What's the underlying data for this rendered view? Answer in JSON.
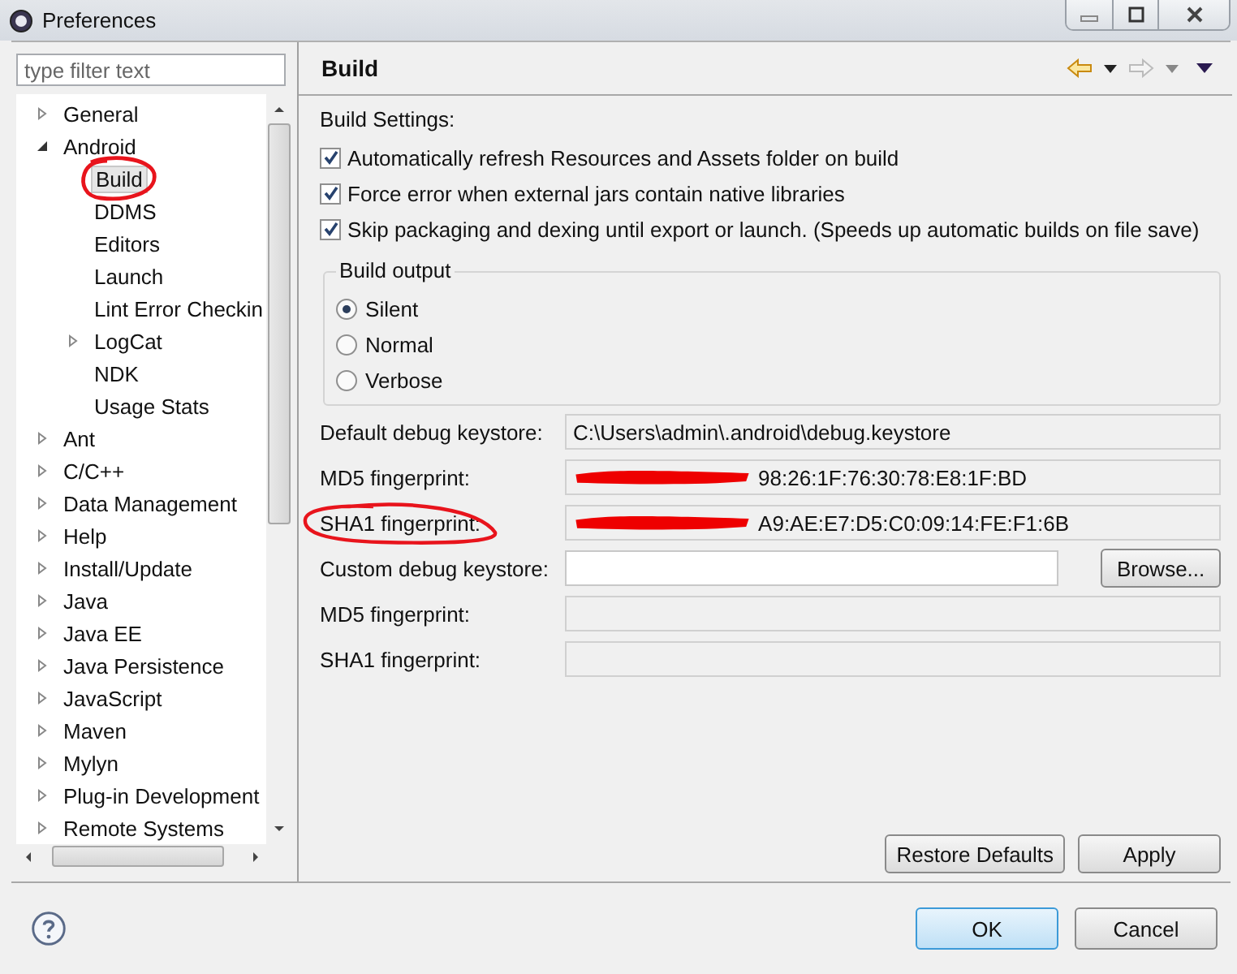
{
  "window": {
    "title": "Preferences"
  },
  "filter": {
    "placeholder": "type filter text"
  },
  "tree": [
    {
      "label": "General",
      "expanded": false,
      "selected": false
    },
    {
      "label": "Android",
      "expanded": true,
      "selected": false,
      "children": [
        {
          "label": "Build",
          "selected": true,
          "circled": true
        },
        {
          "label": "DDMS",
          "selected": false
        },
        {
          "label": "Editors",
          "selected": false
        },
        {
          "label": "Launch",
          "selected": false
        },
        {
          "label": "Lint Error Checkin",
          "selected": false
        },
        {
          "label": "LogCat",
          "expanded": false,
          "selected": false
        },
        {
          "label": "NDK",
          "selected": false
        },
        {
          "label": "Usage Stats",
          "selected": false
        }
      ]
    },
    {
      "label": "Ant",
      "expanded": false,
      "selected": false
    },
    {
      "label": "C/C++",
      "expanded": false,
      "selected": false
    },
    {
      "label": "Data Management",
      "expanded": false,
      "selected": false
    },
    {
      "label": "Help",
      "expanded": false,
      "selected": false
    },
    {
      "label": "Install/Update",
      "expanded": false,
      "selected": false
    },
    {
      "label": "Java",
      "expanded": false,
      "selected": false
    },
    {
      "label": "Java EE",
      "expanded": false,
      "selected": false
    },
    {
      "label": "Java Persistence",
      "expanded": false,
      "selected": false
    },
    {
      "label": "JavaScript",
      "expanded": false,
      "selected": false
    },
    {
      "label": "Maven",
      "expanded": false,
      "selected": false
    },
    {
      "label": "Mylyn",
      "expanded": false,
      "selected": false
    },
    {
      "label": "Plug-in Development",
      "expanded": false,
      "selected": false
    },
    {
      "label": "Remote Systems",
      "expanded": false,
      "selected": false
    }
  ],
  "page": {
    "title": "Build",
    "section": "Build Settings:",
    "options": [
      {
        "label": "Automatically refresh Resources and Assets folder on build",
        "checked": true
      },
      {
        "label": "Force error when external jars contain native libraries",
        "checked": true
      },
      {
        "label": "Skip packaging and dexing until export or launch. (Speeds up automatic builds on file save)",
        "checked": true
      }
    ],
    "build_output": {
      "title": "Build output",
      "choices": [
        {
          "label": "Silent",
          "selected": true
        },
        {
          "label": "Normal",
          "selected": false
        },
        {
          "label": "Verbose",
          "selected": false
        }
      ]
    },
    "fields": [
      {
        "kind": "readonly",
        "label": "Default debug keystore:",
        "value": "C:\\Users\\admin\\.android\\debug.keystore"
      },
      {
        "kind": "readonly",
        "label": "MD5 fingerprint:",
        "value": "98:26:1F:76:30:78:E8:1F:BD",
        "redacted": true
      },
      {
        "kind": "readonly",
        "label": "SHA1 fingerprint:",
        "value": "A9:AE:E7:D5:C0:09:14:FE:F1:6B",
        "redacted": true,
        "circled": true
      },
      {
        "kind": "browse",
        "label": "Custom debug keystore:",
        "button": "Browse..."
      },
      {
        "kind": "readonly",
        "label": "MD5 fingerprint:"
      },
      {
        "kind": "readonly",
        "label": "SHA1 fingerprint:"
      }
    ],
    "buttons": [
      "Restore Defaults",
      "Apply"
    ]
  },
  "dialog_buttons": [
    {
      "label": "OK",
      "default": true
    },
    {
      "label": "Cancel",
      "default": false
    }
  ]
}
